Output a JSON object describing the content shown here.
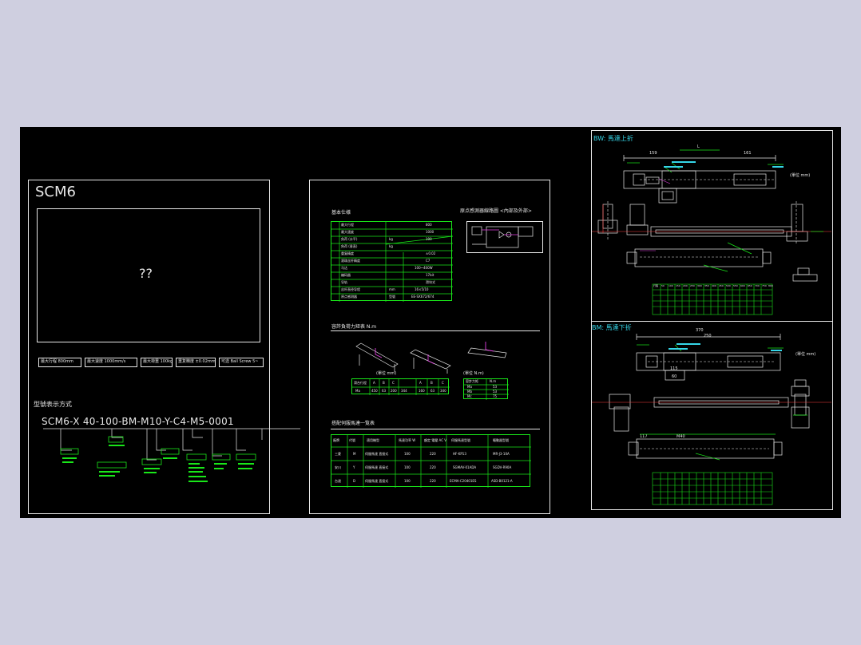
{
  "panel1": {
    "title": "SCM6",
    "photo_placeholder": "??",
    "spec_badges": [
      "最大行程 800mm",
      "最大速度 1000mm/s",
      "最大荷重 100kg",
      "重复精度 ±0.02mm",
      "可选 Ball Screw 5~"
    ],
    "model_heading": "型號表示方式",
    "model_code": "SCM6-X 40-100-BM-M10-Y-C4-M5-0001"
  },
  "panel2": {
    "spec_title": "基本仕様",
    "spec_rows": [
      [
        "最大行程",
        "",
        "800"
      ],
      [
        "最大速度",
        "mm/s",
        "1000"
      ],
      [
        "負荷 (水平)",
        "kg",
        "100"
      ],
      [
        "負荷 (垂直)",
        "kg",
        "30"
      ],
      [
        "重复精度",
        "mm",
        "±0.02"
      ],
      [
        "滚珠丝杆精度",
        "",
        "C7"
      ],
      [
        "马达",
        "",
        "100~400W"
      ],
      [
        "编码器",
        "",
        "17bit"
      ],
      [
        "导轨",
        "",
        "滑块式"
      ],
      [
        "丝杆直径导程",
        "mm",
        "16×5/10"
      ],
      [
        "原点感测器",
        "型號",
        "EE-SX672/674"
      ]
    ],
    "diagram_title": "原点感測器線路圖 <內部及外部>",
    "moment_title": "容許負荷力矩表 N.m",
    "moment_table1_caption": "(單位 mm)",
    "moment_table1_headers": [
      "滑台行程",
      "A",
      "B",
      "C",
      "A",
      "B",
      "C"
    ],
    "moment_table1_row": [
      "Ma",
      "450",
      "63",
      "200",
      "344",
      "160",
      "63",
      "340"
    ],
    "moment_table2_caption": "(單位 N.m)",
    "moment_table2_headers": [
      "容許力矩",
      "N.m"
    ],
    "moment_table2_rows": [
      [
        "Ma",
        "53"
      ],
      [
        "Mb",
        "53"
      ],
      [
        "Mc",
        "75"
      ]
    ],
    "motor_title": "搭配伺服馬達一覧表",
    "motor_headers": [
      "廠牌",
      "代號",
      "適用機型",
      "馬達功率 W",
      "額定 電壓 AC V",
      "伺服馬達型號",
      "驅動器型號"
    ],
    "motor_rows": [
      [
        "三菱",
        "M",
        "伺服馬達 直接式",
        "100",
        "220",
        "HF-KP13",
        "MR-J3-10A"
      ],
      [
        "安川",
        "Y",
        "伺服馬達 直接式",
        "100",
        "220",
        "SGMAV-01ADA",
        "SGDV-R90A"
      ],
      [
        "台達",
        "D",
        "伺服馬達 直接式",
        "100",
        "220",
        "ECMA-C20401ES",
        "ASD-B0121-A"
      ]
    ]
  },
  "panel3": {
    "bw_title": "BW: 馬達上折",
    "bm_title": "BM: 馬達下折",
    "dims": [
      "159",
      "L",
      "161",
      "370",
      "250",
      "115",
      "60",
      "117",
      "M40"
    ],
    "unit_note": "(單位 mm)",
    "table_header": [
      "行程",
      "50",
      "100",
      "150",
      "200",
      "250",
      "300",
      "350",
      "400",
      "450",
      "500",
      "550",
      "600",
      "650",
      "700",
      "750",
      "800"
    ]
  },
  "colors": {
    "frame": "#e8e8e8",
    "green": "#19e619",
    "cyan": "#35d6e8",
    "magenta": "#e040e0",
    "background": "#000000"
  }
}
